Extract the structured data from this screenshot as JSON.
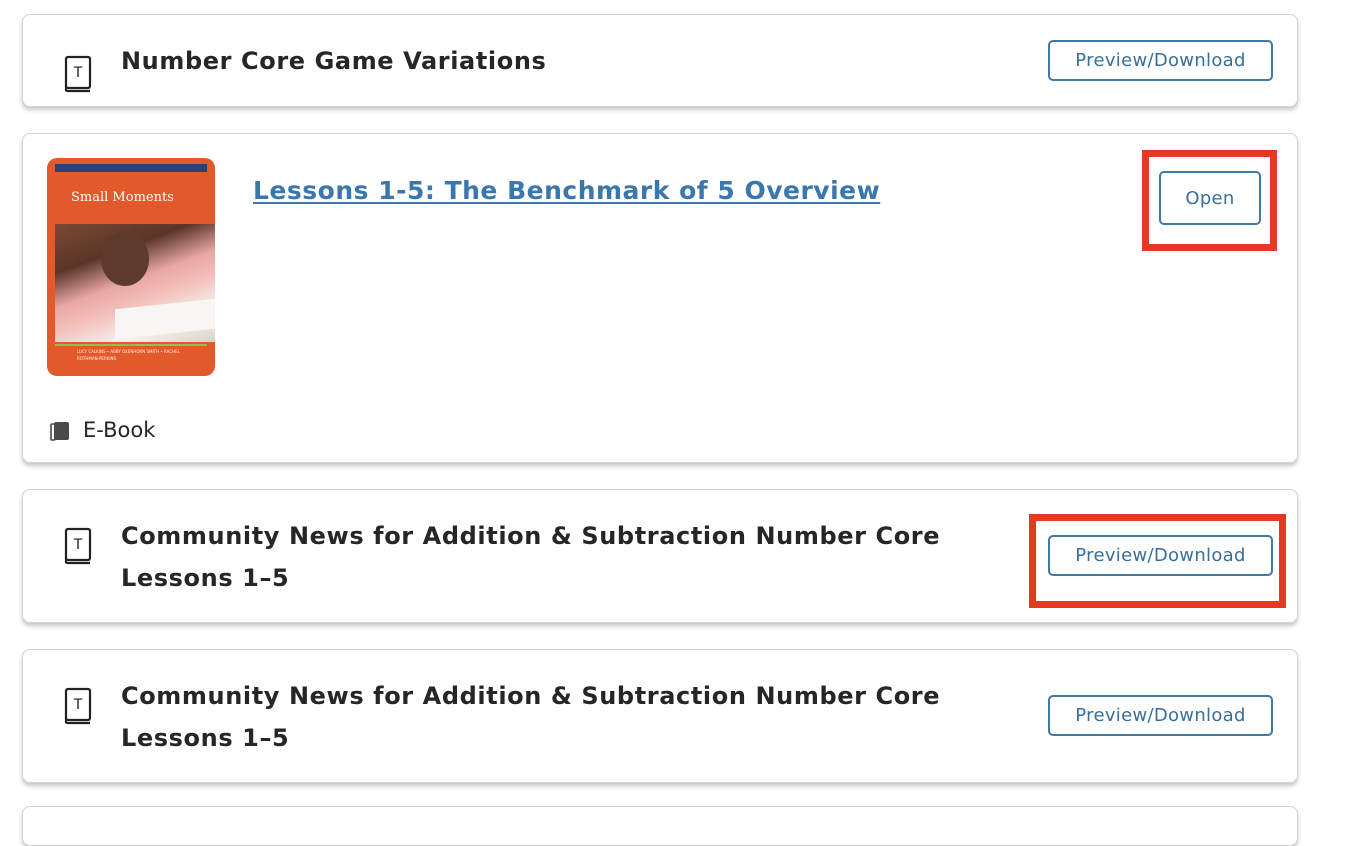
{
  "cards": [
    {
      "title": "Number Core Game Variations",
      "icon": "teacher-guide-icon",
      "button_label": "Preview/Download"
    },
    {
      "cover_title": "Small Moments",
      "cover_authors": "LUCY CALKINS • ABBY OXENHORN SMITH • RACHEL ROTHMAN-PERKINS",
      "link_text": "Lessons 1-5: The Benchmark of 5 Overview",
      "button_label": "Open",
      "type_label": "E-Book",
      "type_icon": "ebook-icon"
    },
    {
      "title_line1": "Community News for Addition & Subtraction Number Core",
      "title_line2": "Lessons 1–5",
      "icon": "teacher-guide-icon",
      "button_label": "Preview/Download"
    },
    {
      "title_line1": "Community News for Addition & Subtraction Number Core",
      "title_line2": "Lessons 1–5",
      "icon": "teacher-guide-icon",
      "button_label": "Preview/Download"
    }
  ],
  "colors": {
    "button_border": "#3f79a6",
    "link": "#3a77ad",
    "highlight": "#e53a22",
    "title_text": "#262626"
  }
}
